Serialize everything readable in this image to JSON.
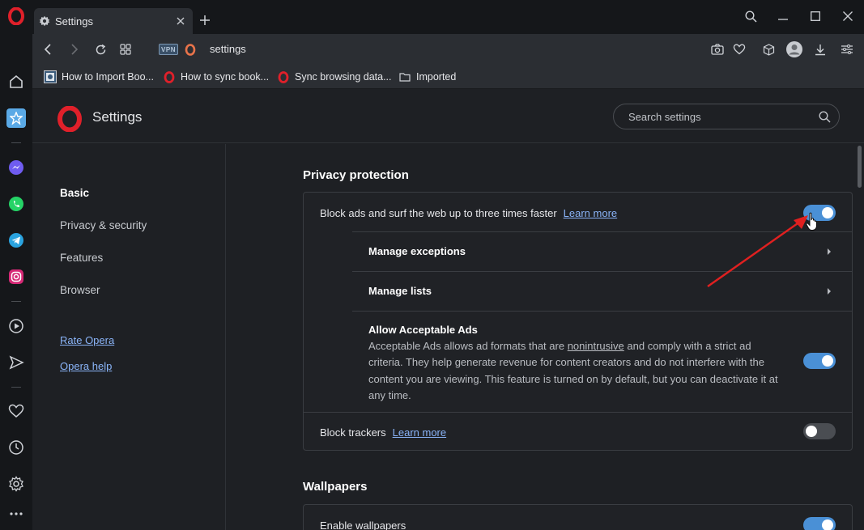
{
  "tab": {
    "title": "Settings"
  },
  "address": {
    "url": "settings",
    "vpn_label": "VPN"
  },
  "bookmarks": [
    {
      "label": "How to Import Boo..."
    },
    {
      "label": "How to sync book..."
    },
    {
      "label": "Sync browsing data..."
    },
    {
      "label": "Imported"
    }
  ],
  "header": {
    "title": "Settings",
    "search_placeholder": "Search settings"
  },
  "sidebar": {
    "items": [
      {
        "label": "Basic",
        "active": true
      },
      {
        "label": "Privacy & security",
        "active": false
      },
      {
        "label": "Features",
        "active": false
      },
      {
        "label": "Browser",
        "active": false
      }
    ],
    "links": [
      {
        "label": "Rate Opera"
      },
      {
        "label": "Opera help"
      }
    ]
  },
  "privacy": {
    "heading": "Privacy protection",
    "block_ads": {
      "label": "Block ads and surf the web up to three times faster",
      "learn_more": "Learn more",
      "enabled": true
    },
    "manage_exceptions": "Manage exceptions",
    "manage_lists": "Manage lists",
    "acceptable_ads": {
      "title": "Allow Acceptable Ads",
      "desc_before": "Acceptable Ads allows ad formats that are ",
      "desc_link": "nonintrusive",
      "desc_after": " and comply with a strict ad criteria. They help generate revenue for content creators and do not interfere with the content you are viewing. This feature is turned on by default, but you can deactivate it at any time.",
      "enabled": true
    },
    "block_trackers": {
      "label": "Block trackers",
      "learn_more": "Learn more",
      "enabled": false
    }
  },
  "wallpapers": {
    "heading": "Wallpapers",
    "enable": {
      "label": "Enable wallpapers",
      "enabled": true
    }
  },
  "colors": {
    "accent": "#4a90d6",
    "link": "#8ab4f8",
    "opera_red": "#e0202a",
    "annotation_arrow": "#e02020"
  }
}
